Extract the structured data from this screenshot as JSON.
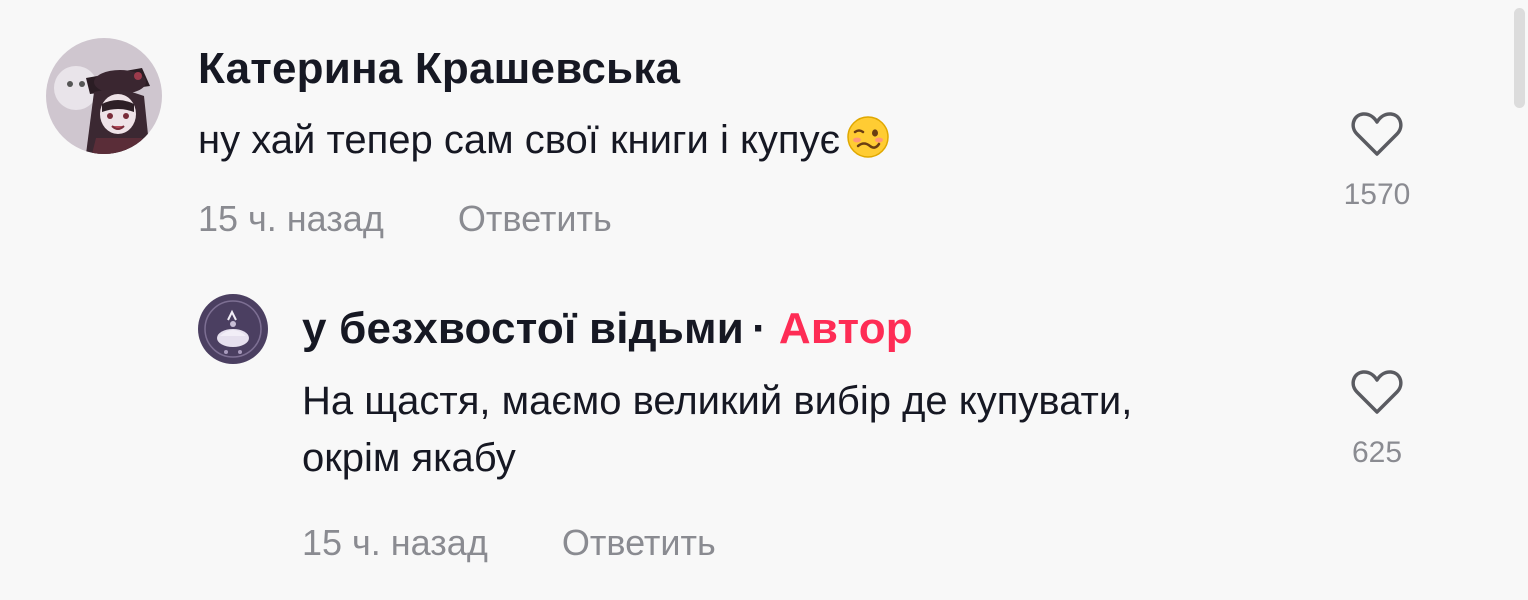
{
  "comments": [
    {
      "author": "Катерина Крашевська",
      "text": "ну хай тепер сам свої книги і купує",
      "emoji": "woozy-face-emoji",
      "time": "15 ч. назад",
      "reply_label": "Ответить",
      "likes": "1570"
    },
    {
      "author": "у безхвостої відьми",
      "separator": "·",
      "badge": "Автор",
      "text_lines": [
        "На щастя, маємо великий вибір де купувати,",
        "окрім якабу"
      ],
      "time": "15 ч. назад",
      "reply_label": "Ответить",
      "likes": "625"
    }
  ],
  "colors": {
    "author_badge": "#fe2c55",
    "meta_text": "#8a8b91",
    "background": "#f8f8f8"
  }
}
